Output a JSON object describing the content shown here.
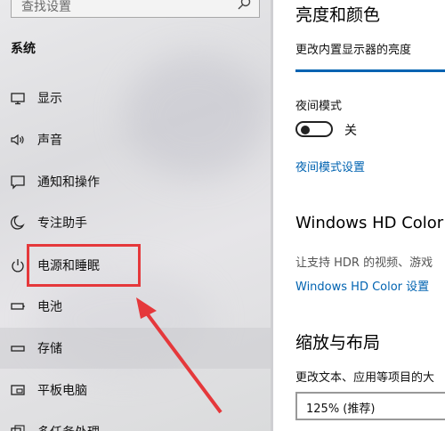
{
  "sidebar": {
    "search_placeholder": "查找设置",
    "section_title": "系统",
    "items": [
      {
        "label": "显示",
        "icon": "monitor-icon"
      },
      {
        "label": "声音",
        "icon": "speaker-icon"
      },
      {
        "label": "通知和操作",
        "icon": "message-icon"
      },
      {
        "label": "专注助手",
        "icon": "moon-icon"
      },
      {
        "label": "电源和睡眠",
        "icon": "power-icon"
      },
      {
        "label": "电池",
        "icon": "battery-icon"
      },
      {
        "label": "存储",
        "icon": "storage-icon"
      },
      {
        "label": "平板电脑",
        "icon": "tablet-icon"
      },
      {
        "label": "多任务处理",
        "icon": "multitask-icon"
      }
    ],
    "selected_item": "存储"
  },
  "annotation": {
    "box_color": "#e5383b",
    "arrow_color": "#e5383b"
  },
  "main": {
    "brightness_title": "亮度和颜色",
    "brightness_desc": "更改内置显示器的亮度",
    "night_mode_label": "夜间模式",
    "night_mode_state": "关",
    "night_mode_link": "夜间模式设置",
    "hd_color_title": "Windows HD Color",
    "hd_color_desc": "让支持 HDR 的视频、游戏",
    "hd_color_link": "Windows HD Color 设置",
    "scale_title": "缩放与布局",
    "scale_desc": "更改文本、应用等项目的大",
    "scale_value": "125% (推荐)"
  },
  "colors": {
    "accent": "#0063b1",
    "highlight": "#e5383b"
  }
}
